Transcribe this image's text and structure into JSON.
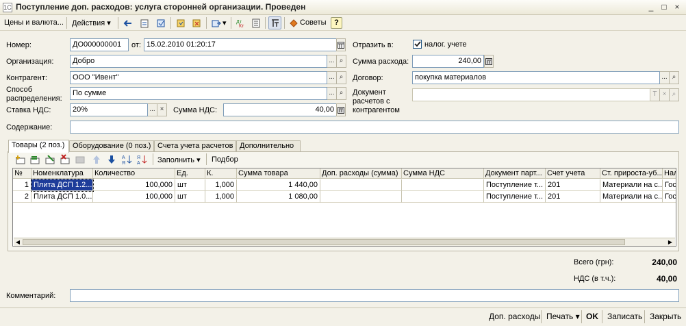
{
  "window": {
    "title": "Поступление доп. расходов: услуга сторонней организации. Проведен",
    "min": "_",
    "max": "□",
    "close": "×",
    "icon": "1C"
  },
  "toolbar": {
    "prices_label": "Цены и валюта...",
    "actions_label": "Действия",
    "advice_label": "Советы",
    "help_label": "?",
    "dropdown_arrow": "▾"
  },
  "form": {
    "number_label": "Номер:",
    "number_value": "ДО000000001",
    "from_label": "от:",
    "date_value": "15.02.2010 01:20:17",
    "org_label": "Организация:",
    "org_value": "Добро",
    "contractor_label": "Контрагент:",
    "contractor_value": "ООО \"Ивент\"",
    "distribution_label_1": "Способ",
    "distribution_label_2": "распределения:",
    "distribution_value": "По сумме",
    "vat_rate_label": "Ставка НДС:",
    "vat_rate_value": "20%",
    "vat_sum_label": "Сумма НДС:",
    "vat_sum_value": "40,00",
    "content_label": "Содержание:",
    "content_value": "",
    "reflect_label": "Отразить в:",
    "tax_account_label": "налог. учете",
    "tax_account_checked": true,
    "expense_sum_label": "Сумма расхода:",
    "expense_sum_value": "240,00",
    "contract_label": "Договор:",
    "contract_value": "покупка материалов",
    "settlement_doc_label_1": "Документ",
    "settlement_doc_label_2": "расчетов с",
    "settlement_doc_label_3": "контрагентом",
    "settlement_doc_value": "",
    "ellipsis": "...",
    "search_glyph": "⌕",
    "clear_glyph": "×",
    "t_glyph": "T"
  },
  "tabs": [
    {
      "label": "Товары (2 поз.)",
      "active": true
    },
    {
      "label": "Оборудование (0 поз.)",
      "active": false
    },
    {
      "label": "Счета учета расчетов",
      "active": false
    },
    {
      "label": "Дополнительно",
      "active": false
    }
  ],
  "grid_toolbar": {
    "fill_label": "Заполнить",
    "selection_label": "Подбор"
  },
  "table": {
    "columns": [
      "№",
      "Номенклатура",
      "Количество",
      "Ед.",
      "К.",
      "Сумма товара",
      "Доп. расходы (сумма)",
      "Сумма НДС",
      "Документ парт...",
      "Счет учета",
      "Ст. прироста-уб...",
      "Нал"
    ],
    "rows": [
      [
        "1",
        "Плита ДСП 1.2...",
        "100,000",
        "шт",
        "1,000",
        "1 440,00",
        "",
        "",
        "Поступление т...",
        "201",
        "Материали на с...",
        "Гос"
      ],
      [
        "2",
        "Плита ДСП 1.0...",
        "100,000",
        "шт",
        "1,000",
        "1 080,00",
        "",
        "",
        "Поступление т...",
        "201",
        "Материали на с...",
        "Гос"
      ]
    ]
  },
  "totals": {
    "total_label": "Всего (грн):",
    "total_value": "240,00",
    "vat_label": "НДС (в т.ч.):",
    "vat_value": "40,00"
  },
  "comment": {
    "label": "Комментарий:",
    "value": ""
  },
  "bottom_bar": {
    "extra_costs": "Доп. расходы",
    "print": "Печать",
    "ok": "OK",
    "save": "Записать",
    "close": "Закрыть"
  },
  "colors": {
    "selection": "#1e3c9a",
    "field_border": "#7f9db9",
    "background": "#f3f1e8"
  }
}
